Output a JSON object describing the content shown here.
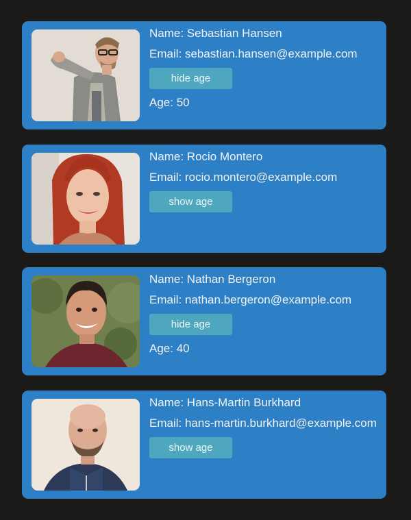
{
  "labels": {
    "name_prefix": "Name: ",
    "email_prefix": "Email: ",
    "age_prefix": "Age: "
  },
  "users": [
    {
      "name": "Sebastian Hansen",
      "email": "sebastian.hansen@example.com",
      "button_label": "hide age",
      "age_visible": true,
      "age": "50"
    },
    {
      "name": "Rocio Montero",
      "email": "rocio.montero@example.com",
      "button_label": "show age",
      "age_visible": false
    },
    {
      "name": "Nathan Bergeron",
      "email": "nathan.bergeron@example.com",
      "button_label": "hide age",
      "age_visible": true,
      "age": "40"
    },
    {
      "name": "Hans-Martin Burkhard",
      "email": "hans-martin.burkhard@example.com",
      "button_label": "show age",
      "age_visible": false
    }
  ],
  "colors": {
    "page_background": "#1c1a18",
    "card_background": "#2d80c5",
    "button_background": "#4ea7be",
    "text": "#f2f2f2"
  }
}
